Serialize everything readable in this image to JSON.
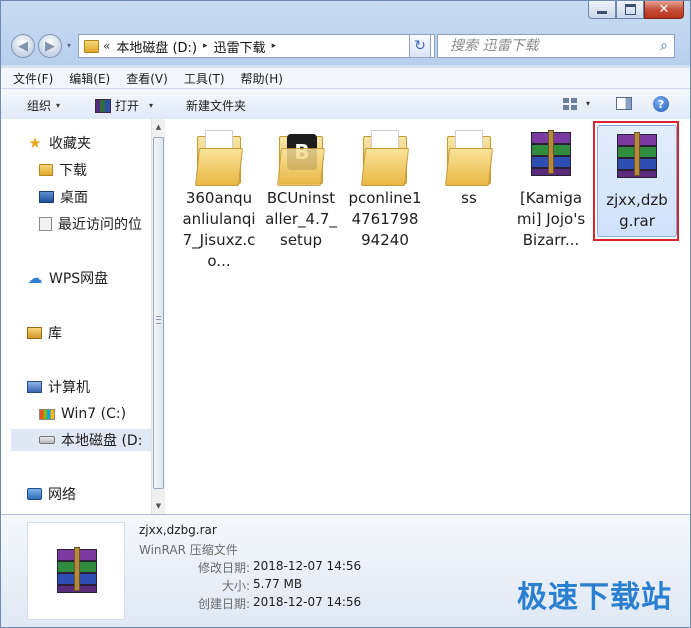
{
  "window": {
    "caption_close": "✕"
  },
  "nav": {
    "back": "◀",
    "forward": "▶",
    "history_caret": "▾",
    "address": {
      "prefix": "«",
      "segments": [
        "本地磁盘 (D:)",
        "迅雷下载"
      ],
      "separator": "▸",
      "dropdown": "▾"
    },
    "refresh": "↻",
    "search_placeholder": "搜索 迅雷下载",
    "search_icon": "⌕"
  },
  "menu": [
    "文件(F)",
    "编辑(E)",
    "查看(V)",
    "工具(T)",
    "帮助(H)"
  ],
  "commands": {
    "organize": "组织",
    "open": "打开",
    "new_folder": "新建文件夹",
    "caret": "▾",
    "help": "?"
  },
  "sidebar": {
    "items": [
      {
        "label": "收藏夹",
        "icon": "star-icon"
      },
      {
        "label": "下载",
        "icon": "folder-icon"
      },
      {
        "label": "桌面",
        "icon": "desktop-icon"
      },
      {
        "label": "最近访问的位",
        "icon": "recent-icon"
      },
      {
        "label": "WPS网盘",
        "icon": "cloud-icon"
      },
      {
        "label": "库",
        "icon": "library-icon"
      },
      {
        "label": "计算机",
        "icon": "computer-icon"
      },
      {
        "label": "Win7 (C:)",
        "icon": "windows-drive-icon"
      },
      {
        "label": "本地磁盘 (D:",
        "icon": "drive-icon"
      },
      {
        "label": "网络",
        "icon": "network-icon"
      }
    ],
    "star_glyph": "★",
    "cloud_glyph": "☁"
  },
  "scrollbar": {
    "up": "▲",
    "down": "▼"
  },
  "files": [
    {
      "name": "360anquanliulanqi7_Jisuxz.co...",
      "icon": "folder-icon"
    },
    {
      "name": "BCUninstaller_4.7_setup",
      "icon": "folder-bcuninstaller-icon"
    },
    {
      "name": "pconline1476179894240",
      "icon": "folder-icon"
    },
    {
      "name": "ss",
      "icon": "folder-icon"
    },
    {
      "name": "[Kamigami] Jojo's Bizarr...",
      "icon": "winrar-icon"
    },
    {
      "name": "zjxx,dzbg.rar",
      "icon": "winrar-icon"
    }
  ],
  "bc_glyph": "B",
  "details": {
    "name": "zjxx,dzbg.rar",
    "type": "WinRAR 压缩文件",
    "rows": [
      {
        "label": "修改日期:",
        "value": "2018-12-07 14:56"
      },
      {
        "label": "大小:",
        "value": "5.77 MB"
      },
      {
        "label": "创建日期:",
        "value": "2018-12-07 14:56"
      }
    ]
  },
  "watermark": "极速下载站",
  "colors": {
    "selection": "#cfe2fb",
    "highlight_border": "#d5272b",
    "watermark": "#2a7fd0"
  }
}
